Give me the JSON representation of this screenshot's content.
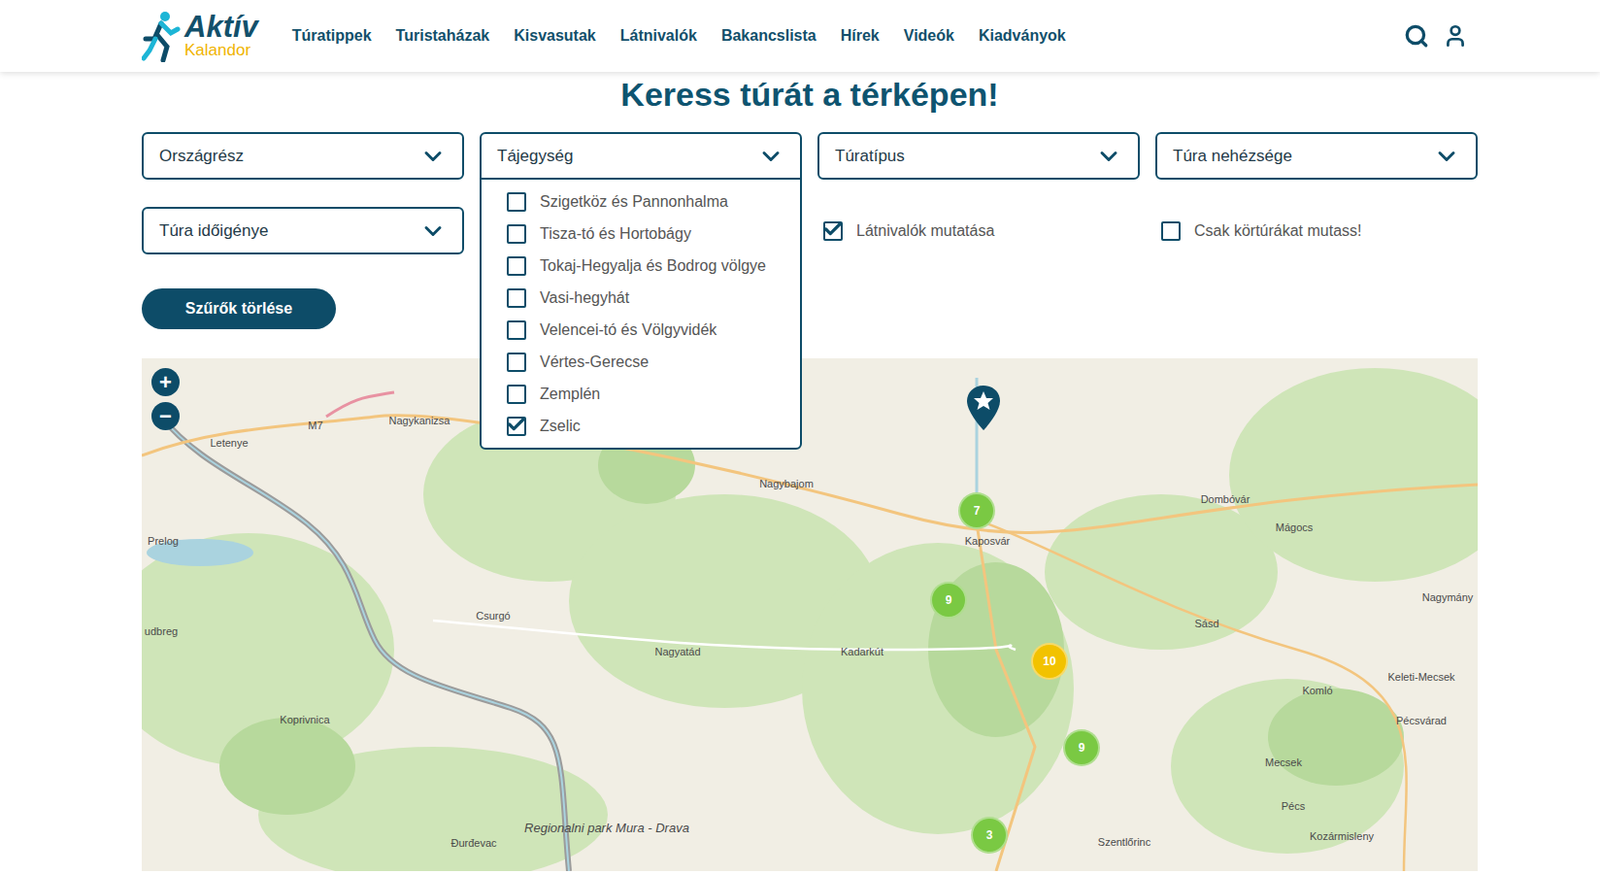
{
  "logo": {
    "name": "Aktív",
    "sub": "Kalandor"
  },
  "nav": [
    "Túratippek",
    "Turistaházak",
    "Kisvasutak",
    "Látnivalók",
    "Bakancslista",
    "Hírek",
    "Videók",
    "Kiadványok"
  ],
  "title": "Keress túrát a térképen!",
  "filters": [
    {
      "label": "Országrész",
      "open": false
    },
    {
      "label": "Tájegység",
      "open": true
    },
    {
      "label": "Túratípus",
      "open": false
    },
    {
      "label": "Túra nehézsége",
      "open": false
    },
    {
      "label": "Túra időigénye",
      "open": false
    }
  ],
  "region_options": [
    {
      "label": "Szigetköz és Pannonhalma",
      "checked": false
    },
    {
      "label": "Tisza-tó és Hortobágy",
      "checked": false
    },
    {
      "label": "Tokaj-Hegyalja és Bodrog völgye",
      "checked": false
    },
    {
      "label": "Vasi-hegyhát",
      "checked": false
    },
    {
      "label": "Velencei-tó és Völgyvidék",
      "checked": false
    },
    {
      "label": "Vértes-Gerecse",
      "checked": false
    },
    {
      "label": "Zemplén",
      "checked": false
    },
    {
      "label": "Zselic",
      "checked": true
    }
  ],
  "toggles": [
    {
      "label": "Látnivalók mutatása",
      "checked": true
    },
    {
      "label": "Csak körtúrákat mutass!",
      "checked": false
    }
  ],
  "clear_button": "Szűrők törlése",
  "map": {
    "zoom_in": "+",
    "zoom_out": "−",
    "labels": [
      "Nagykanizsa",
      "Letenye",
      "Prelog",
      "udbreg",
      "Csurgó",
      "Koprivnica",
      "Nagyatád",
      "Kadarkút",
      "Nagybajom",
      "Kaposvár",
      "Dombóvár",
      "Mágocs",
      "Nagymány",
      "Sásd",
      "Keleti-Mecsek",
      "Komló",
      "Pécsvárad",
      "Mecsek",
      "Pécs",
      "Kozármisleny",
      "Szentlőrinc",
      "Đurđevac",
      "Regionalni park Mura - Drava",
      "M7"
    ],
    "clusters": [
      {
        "count": "7",
        "color": "#7ac943"
      },
      {
        "count": "9",
        "color": "#7ac943"
      },
      {
        "count": "10",
        "color": "#f2c200"
      },
      {
        "count": "9",
        "color": "#7ac943"
      },
      {
        "count": "3",
        "color": "#7ac943"
      }
    ]
  }
}
